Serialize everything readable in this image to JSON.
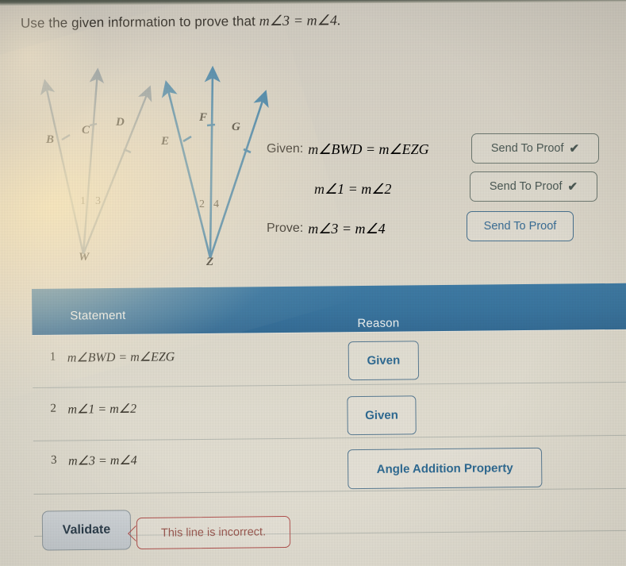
{
  "prompt": {
    "lead": "Use the given information to prove that",
    "statement": "m∠3 = m∠4."
  },
  "figure": {
    "left": {
      "vertex": "W",
      "rays": [
        "B",
        "C",
        "D"
      ],
      "angles": [
        "1",
        "3"
      ]
    },
    "right": {
      "vertex": "Z",
      "rays": [
        "E",
        "F",
        "G"
      ],
      "angles": [
        "2",
        "4"
      ]
    },
    "ray_color": "#3f82ab"
  },
  "givens": {
    "given_label": "Given:",
    "prove_label": "Prove:",
    "rows": [
      {
        "text": "m∠BWD = m∠EZG",
        "button": "Send To Proof",
        "sent": true,
        "check": "✔"
      },
      {
        "text": "m∠1 = m∠2",
        "button": "Send To Proof",
        "sent": true,
        "check": "✔"
      },
      {
        "text": "m∠3 = m∠4",
        "button": "Send To Proof",
        "sent": false,
        "check": ""
      }
    ]
  },
  "table": {
    "header_color": "#3a76a0",
    "columns": [
      "Statement",
      "Reason"
    ],
    "rows": [
      {
        "num": "1",
        "statement": "m∠BWD = m∠EZG",
        "reason": "Given"
      },
      {
        "num": "2",
        "statement": "m∠1 = m∠2",
        "reason": "Given"
      },
      {
        "num": "3",
        "statement": "m∠3 = m∠4",
        "reason": "Angle Addition Property"
      }
    ]
  },
  "footer": {
    "validate": "Validate",
    "error": "This line is incorrect.",
    "error_color": "#b4524f"
  }
}
